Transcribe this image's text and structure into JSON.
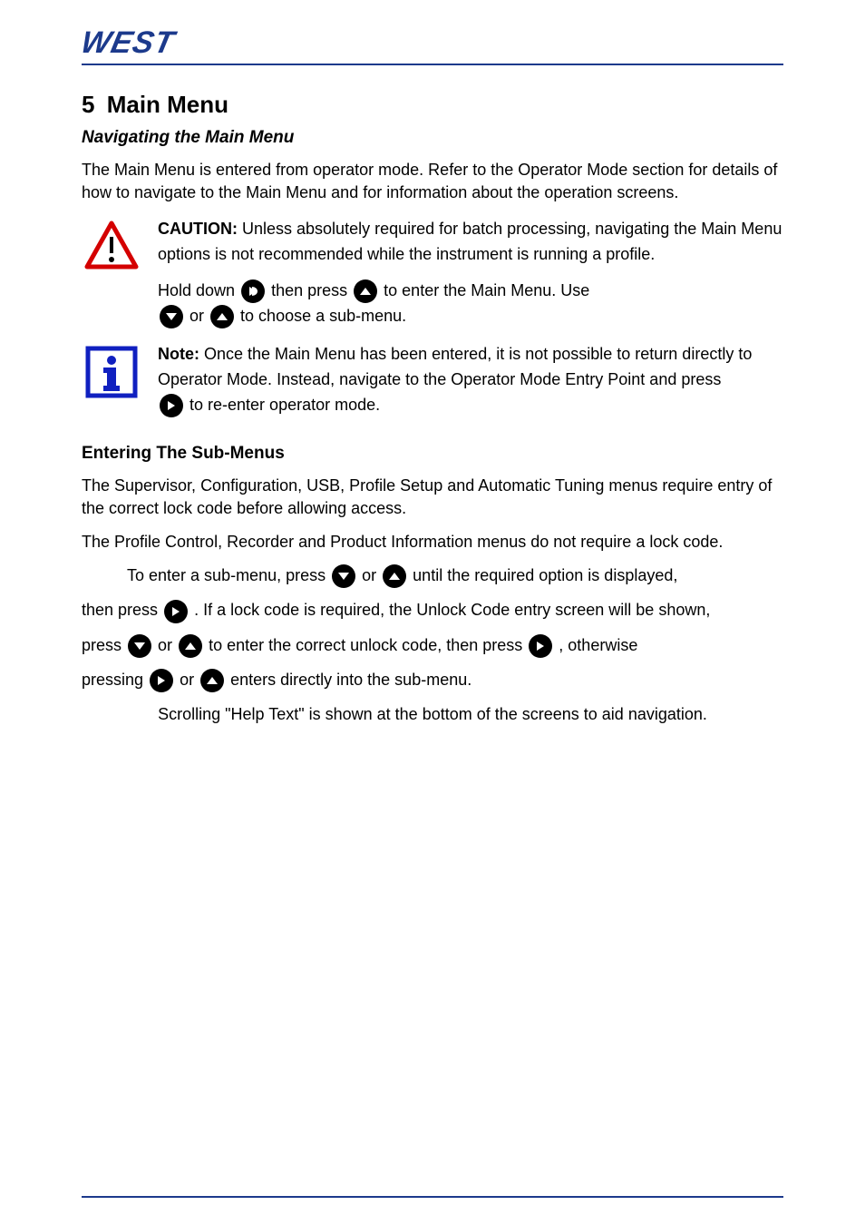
{
  "brand": "WEST",
  "section": {
    "number": "5",
    "title": "Main Menu",
    "sub": "Navigating the Main Menu"
  },
  "p1": "The Main Menu is entered from operator mode. Refer to the Operator Mode section for details of how to navigate to the Main Menu and for information about the operation screens.",
  "caution_label": "CAUTION:",
  "caution_body": " Unless absolutely required for batch processing, navigating the Main Menu options is not recommended while the instrument is running a profile.",
  "caution_line2a": "Hold down ",
  "caution_line2b": " then press ",
  "caution_line2c": " to enter the Main Menu. Use",
  "caution_line3a": "",
  "caution_line3b": " or ",
  "caution_line3c": " to choose a sub-menu.",
  "note_label": "Note:",
  "note_body": " Once the Main Menu has been entered, it is not possible to return directly to Operator Mode. Instead, navigate to the Operator Mode Entry Point and press",
  "note_line2": " to re-enter operator mode.",
  "submenu_heading": "Entering The Sub-Menus",
  "p2": "The Supervisor, Configuration, USB, Profile Setup and Automatic Tuning menus require entry of the correct lock code before allowing access.",
  "p3": "The Profile Control, Recorder and Product Information menus do not require a lock code.",
  "line4a": "To enter a sub-menu, press ",
  "line4b": " or ",
  "line4c": " until the required option is displayed,",
  "line5a": "then press ",
  "line5b": ". If a lock code is required, the Unlock Code entry screen will be shown,",
  "line6a": "press ",
  "line6b": " or ",
  "line6c": " to enter the correct unlock code, then press ",
  "line6d": ", otherwise",
  "line7a": "pressing ",
  "line7b": " or ",
  "line7c": " enters directly into the sub-menu.",
  "help_text": "Scrolling \"Help Text\" is shown at the bottom of the screens to aid navigation."
}
